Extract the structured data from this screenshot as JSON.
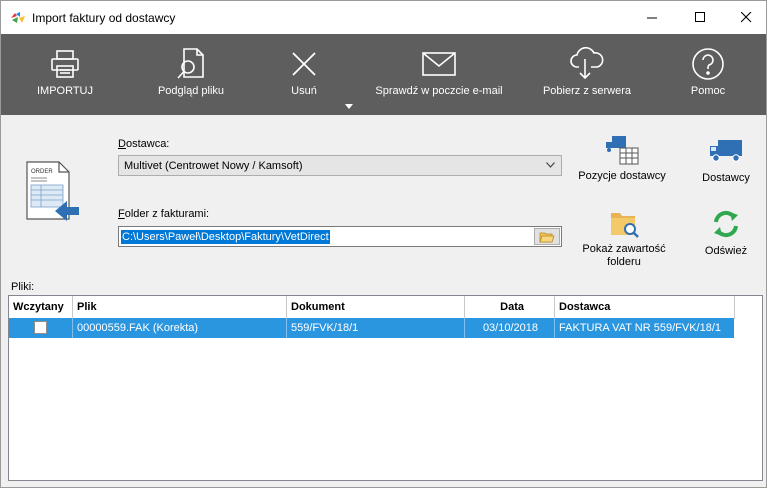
{
  "window": {
    "title": "Import faktury od dostawcy"
  },
  "toolbar": {
    "import_label": "IMPORTUJ",
    "preview_label": "Podgląd pliku",
    "delete_label": "Usuń",
    "check_email_label": "Sprawdź w poczcie e-mail",
    "download_label": "Pobierz z serwera",
    "help_label": "Pomoc"
  },
  "form": {
    "supplier_label_first": "D",
    "supplier_label_rest": "ostawca:",
    "supplier_value": "Multivet (Centrowet Nowy / Kamsoft)",
    "folder_label_first": "F",
    "folder_label_rest": "older z fakturami:",
    "folder_value": "C:\\Users\\Paweł\\Desktop\\Faktury\\VetDirect"
  },
  "side_buttons": {
    "supplier_items_label": "Pozycje dostawcy",
    "suppliers_label": "Dostawcy",
    "show_folder_label": "Pokaż zawartość folderu",
    "refresh_label": "Odśwież"
  },
  "files": {
    "label": "Pliki:",
    "columns": {
      "loaded": "Wczytany",
      "file": "Plik",
      "document": "Dokument",
      "date": "Data",
      "supplier": "Dostawca"
    },
    "rows": [
      {
        "file": "00000559.FAK (Korekta)",
        "document": "559/FVK/18/1",
        "date": "03/10/2018",
        "supplier": "FAKTURA VAT NR 559/FVK/18/1"
      }
    ]
  },
  "colors": {
    "toolbar_bg": "#5e5e5e",
    "selection": "#2b96e0",
    "accent_green": "#2fa84f",
    "icon_blue": "#2f6fb3"
  }
}
